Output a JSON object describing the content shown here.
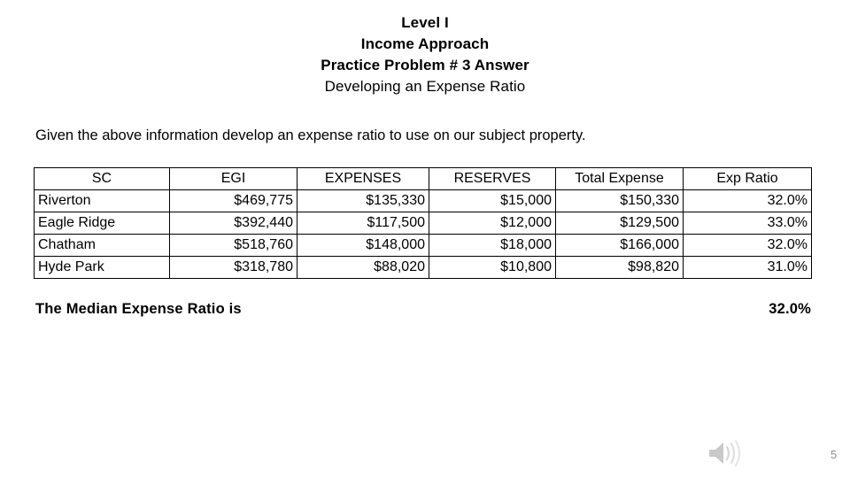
{
  "slide": {
    "title_lines": [
      "Level I",
      "Income Approach",
      "Practice Problem # 3 Answer"
    ],
    "subtitle": "Developing an Expense Ratio",
    "intro": "Given the above information develop an expense ratio to use on our subject property."
  },
  "table": {
    "headers": [
      "SC",
      "EGI",
      "EXPENSES",
      "RESERVES",
      "Total Expense",
      "Exp Ratio"
    ],
    "rows": [
      {
        "sc": "Riverton",
        "egi": "$469,775",
        "expenses": "$135,330",
        "reserves": "$15,000",
        "total_expense": "$150,330",
        "exp_ratio": "32.0%"
      },
      {
        "sc": "Eagle Ridge",
        "egi": "$392,440",
        "expenses": "$117,500",
        "reserves": "$12,000",
        "total_expense": "$129,500",
        "exp_ratio": "33.0%"
      },
      {
        "sc": "Chatham",
        "egi": "$518,760",
        "expenses": "$148,000",
        "reserves": "$18,000",
        "total_expense": "$166,000",
        "exp_ratio": "32.0%"
      },
      {
        "sc": "Hyde Park",
        "egi": "$318,780",
        "expenses": "$88,020",
        "reserves": "$10,800",
        "total_expense": "$98,820",
        "exp_ratio": "31.0%"
      }
    ]
  },
  "median": {
    "label": "The Median Expense Ratio is",
    "value": "32.0%"
  },
  "footer": {
    "audio_icon": "speaker-icon",
    "page_number": "5"
  },
  "colors": {
    "text": "#000000",
    "table_border": "#000000",
    "footer_gray": "#8c8c8c",
    "icon_gray": "#d0d0d0"
  }
}
